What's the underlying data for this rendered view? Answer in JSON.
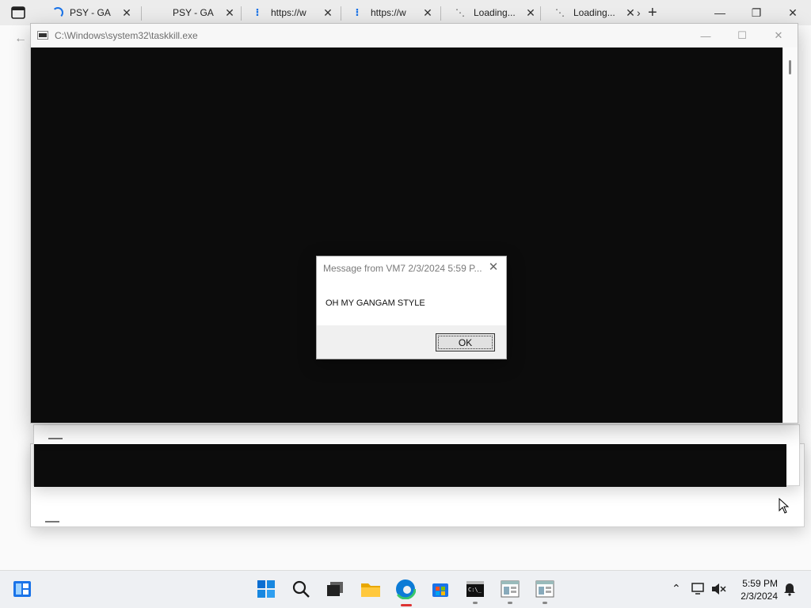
{
  "browser": {
    "tabs": [
      {
        "title": "PSY - GA",
        "icon": "loading-spinner-icon"
      },
      {
        "title": "PSY - GA",
        "icon": "none"
      },
      {
        "title": "https://w",
        "icon": "dots-icon"
      },
      {
        "title": "https://w",
        "icon": "dots-icon"
      },
      {
        "title": "Loading...",
        "icon": "loading-dots-icon"
      },
      {
        "title": "Loading...",
        "icon": "loading-dots-icon"
      }
    ],
    "tab_close_glyph": "✕",
    "new_tab_glyph": "+",
    "scroll_tabs_glyph": "›",
    "window_controls": {
      "minimize": "—",
      "restore": "❐",
      "close": "✕"
    }
  },
  "console_window": {
    "title": "C:\\Windows\\system32\\taskkill.exe",
    "controls": {
      "minimize": "—",
      "maximize": "☐",
      "close": "✕"
    },
    "background_color": "#0c0c0c"
  },
  "message_box": {
    "title": "Message from VM7 2/3/2024 5:59 P...",
    "message": "OH MY GANGAM STYLE",
    "ok_label": "OK",
    "close_glyph": "✕"
  },
  "taskbar": {
    "icons": [
      "widgets-icon",
      "start-icon",
      "search-icon",
      "task-view-icon",
      "file-explorer-icon",
      "edge-icon",
      "store-icon",
      "terminal-icon",
      "app-window-icon",
      "app-window-icon-2"
    ],
    "tray": {
      "chevron": "⌃"
    },
    "clock": {
      "time": "5:59 PM",
      "date": "2/3/2024"
    }
  }
}
